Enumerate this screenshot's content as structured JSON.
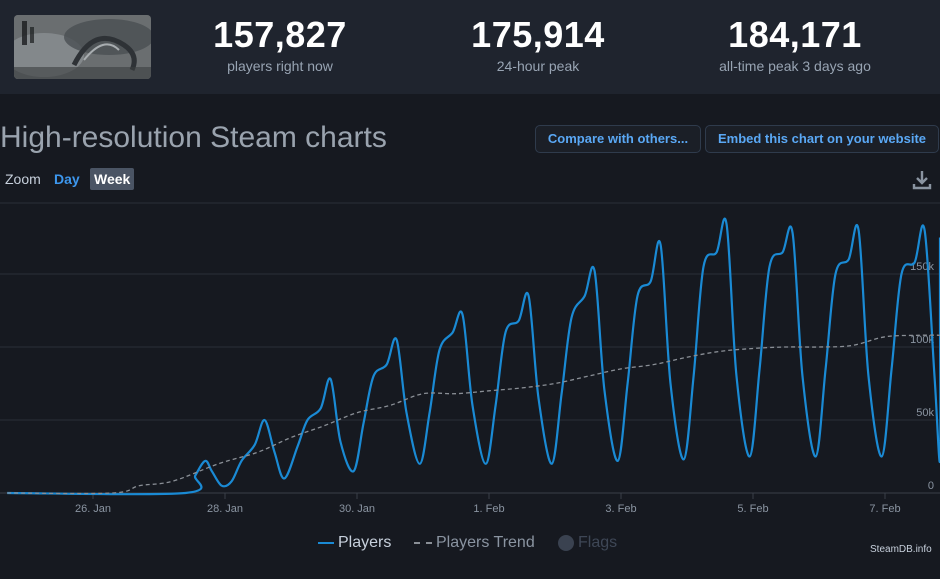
{
  "header": {
    "stats": [
      {
        "value": "157,827",
        "label": "players right now"
      },
      {
        "value": "175,914",
        "label": "24-hour peak"
      },
      {
        "value": "184,171",
        "label": "all-time peak 3 days ago"
      }
    ]
  },
  "page_title": "High-resolution Steam charts",
  "buttons": {
    "compare": "Compare with others...",
    "embed": "Embed this chart on your website"
  },
  "zoom": {
    "label": "Zoom",
    "options": [
      "Day",
      "Week"
    ],
    "selected": "Week"
  },
  "legend": {
    "players": "Players",
    "trend": "Players Trend",
    "flags": "Flags"
  },
  "credit": "SteamDB.info",
  "colors": {
    "players_line": "#1a8ad4",
    "trend_line": "#8a8f96",
    "link": "#5aa8f5",
    "background": "#161920"
  },
  "icons": {
    "download": "download-icon"
  },
  "chart_data": {
    "type": "line",
    "x_tick_labels": [
      "26. Jan",
      "28. Jan",
      "30. Jan",
      "1. Feb",
      "3. Feb",
      "5. Feb",
      "7. Feb"
    ],
    "y_tick_labels": [
      "0",
      "50k",
      "100k",
      "150k"
    ],
    "ylim": [
      0,
      200000
    ],
    "grid": true,
    "x_unit": "days since 26 Jan",
    "series": [
      {
        "name": "Players",
        "style": "solid",
        "x": [
          -1.3,
          1.4,
          1.55,
          1.7,
          1.8,
          1.95,
          2.1,
          2.25,
          2.45,
          2.6,
          2.75,
          2.9,
          3.1,
          3.25,
          3.45,
          3.6,
          3.75,
          3.95,
          4.1,
          4.25,
          4.45,
          4.6,
          4.75,
          4.95,
          5.1,
          5.25,
          5.45,
          5.6,
          5.75,
          5.95,
          6.1,
          6.25,
          6.45,
          6.6,
          6.75,
          6.95,
          7.1,
          7.25,
          7.45,
          7.6,
          7.75,
          7.95,
          8.1,
          8.25,
          8.45,
          8.6,
          8.75,
          8.95,
          9.1,
          9.25,
          9.45,
          9.6,
          9.75,
          9.95,
          10.1,
          10.25,
          10.45,
          10.6,
          10.75,
          10.95,
          11.1,
          11.25,
          11.45,
          11.6,
          11.75,
          11.95,
          12.1,
          12.25,
          12.45,
          12.6,
          12.75,
          12.95,
          13.1,
          13.25
        ],
        "y": [
          0,
          0,
          12000,
          22000,
          15000,
          5000,
          8000,
          22000,
          33000,
          50000,
          28000,
          10000,
          32000,
          50000,
          58000,
          78000,
          35000,
          15000,
          48000,
          80000,
          88000,
          105000,
          55000,
          20000,
          55000,
          98000,
          110000,
          122000,
          60000,
          20000,
          60000,
          110000,
          118000,
          135000,
          65000,
          20000,
          68000,
          120000,
          135000,
          152000,
          70000,
          22000,
          75000,
          135000,
          145000,
          170000,
          75000,
          23000,
          80000,
          155000,
          165000,
          184000,
          80000,
          25000,
          85000,
          155000,
          165000,
          178000,
          80000,
          25000,
          85000,
          150000,
          160000,
          180000,
          80000,
          25000,
          85000,
          150000,
          158000,
          180000,
          80000,
          22000,
          120000,
          175000
        ]
      },
      {
        "name": "Players Trend",
        "style": "dashed",
        "x": [
          -1.3,
          0.3,
          0.7,
          1.2,
          1.9,
          2.5,
          3.0,
          3.5,
          4.0,
          4.5,
          5.0,
          5.5,
          6.0,
          6.5,
          7.0,
          7.5,
          8.0,
          8.5,
          9.0,
          9.5,
          10.0,
          10.5,
          11.0,
          11.5,
          12.0,
          12.5,
          13.0,
          13.3
        ],
        "y": [
          0,
          0,
          5000,
          8000,
          20000,
          28000,
          38000,
          46000,
          55000,
          60000,
          68000,
          68000,
          70000,
          72000,
          75000,
          80000,
          85000,
          88000,
          93000,
          97000,
          99000,
          100000,
          100000,
          101000,
          107000,
          108000,
          108000,
          107000
        ]
      }
    ]
  }
}
